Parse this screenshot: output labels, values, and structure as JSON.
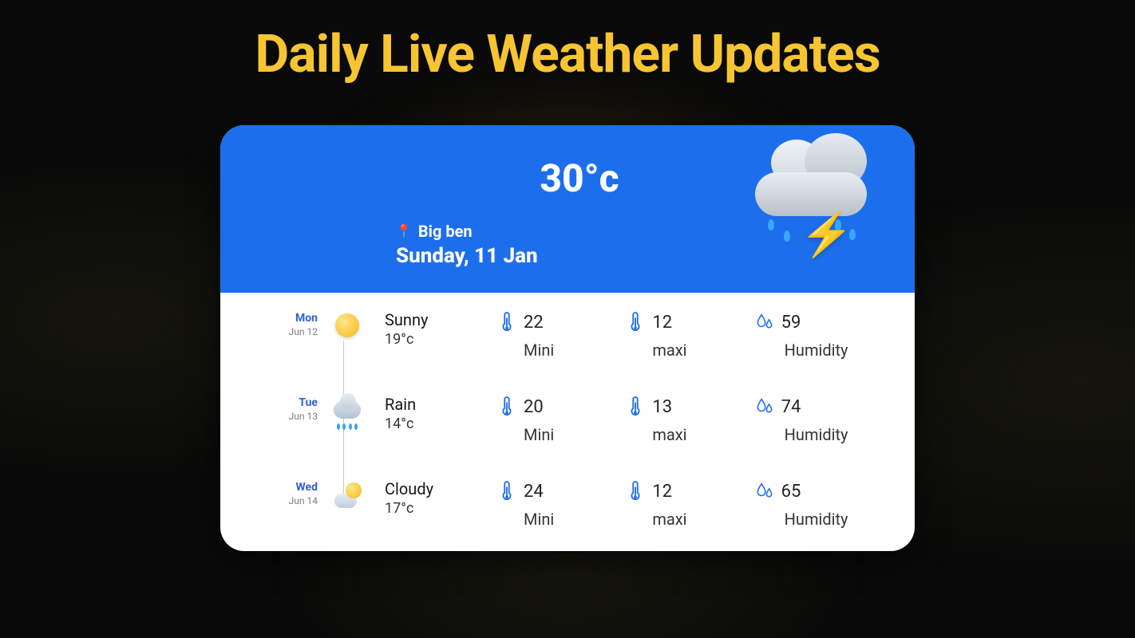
{
  "title": "Daily Live Weather Updates",
  "header": {
    "temperature": "30°c",
    "location": "Big ben",
    "date": "Sunday, 11 Jan"
  },
  "labels": {
    "mini": "Mini",
    "maxi": "maxi",
    "humidity": "Humidity"
  },
  "forecast": [
    {
      "day": "Mon",
      "date": "Jun 12",
      "icon": "sun-icon",
      "condition": "Sunny",
      "temp": "19°c",
      "mini": "22",
      "maxi": "12",
      "humidity": "59"
    },
    {
      "day": "Tue",
      "date": "Jun 13",
      "icon": "rain-icon",
      "condition": "Rain",
      "temp": "14°c",
      "mini": "20",
      "maxi": "13",
      "humidity": "74"
    },
    {
      "day": "Wed",
      "date": "Jun 14",
      "icon": "partly-cloudy-icon",
      "condition": "Cloudy",
      "temp": "17°c",
      "mini": "24",
      "maxi": "12",
      "humidity": "65"
    }
  ]
}
